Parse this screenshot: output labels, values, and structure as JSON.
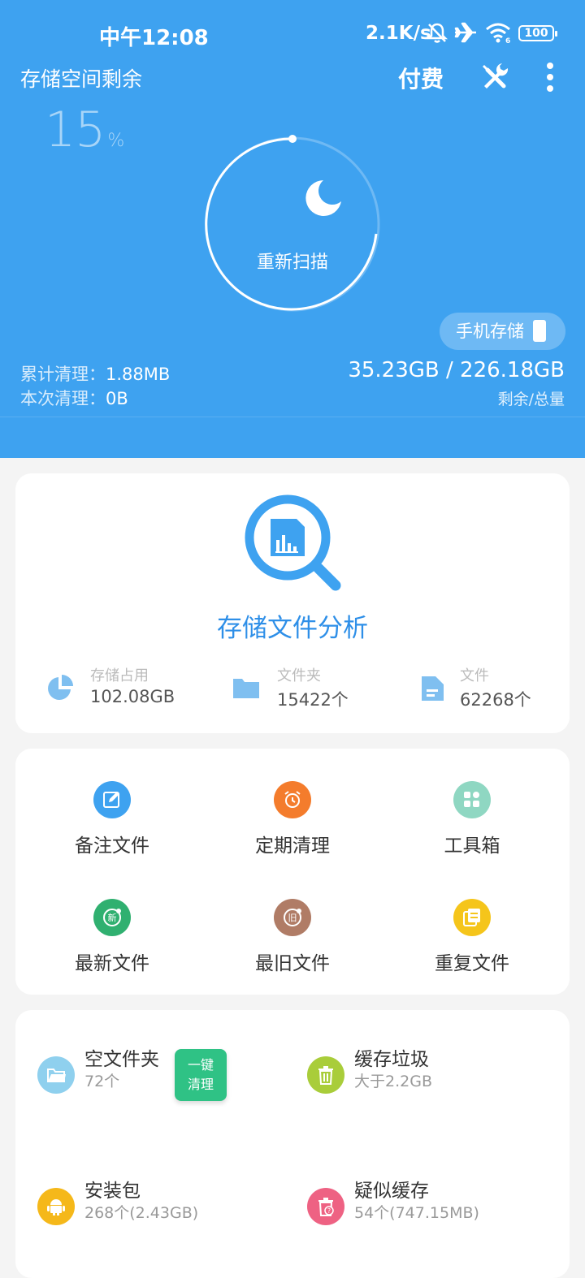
{
  "status_bar": {
    "time": "中午12:08",
    "net_speed": "2.1K/s",
    "battery": "100"
  },
  "header": {
    "title": "存储空间剩余",
    "pay_label": "付费",
    "percent_value": "15",
    "percent_sign": "%",
    "rescan_label": "重新扫描",
    "storage_type_label": "手机存储",
    "cumulative_clean_label": "累计清理：",
    "cumulative_clean_value": "1.88MB",
    "current_clean_label": "本次清理：",
    "current_clean_value": "0B",
    "capacity": "35.23GB / 226.18GB",
    "capacity_label": "剩余/总量"
  },
  "analysis": {
    "title": "存储文件分析",
    "stats": [
      {
        "label": "存储占用",
        "value": "102.08GB",
        "icon": "pie-chart-icon"
      },
      {
        "label": "文件夹",
        "value": "15422个",
        "icon": "folder-icon"
      },
      {
        "label": "文件",
        "value": "62268个",
        "icon": "file-icon"
      }
    ]
  },
  "tools": [
    {
      "label": "备注文件",
      "color": "#3ea2f0",
      "icon": "note-edit-icon"
    },
    {
      "label": "定期清理",
      "color": "#f47c2c",
      "icon": "alarm-clock-icon"
    },
    {
      "label": "工具箱",
      "color": "#8fd7c2",
      "icon": "toolbox-grid-icon"
    },
    {
      "label": "最新文件",
      "color": "#30b070",
      "icon": "new-badge-icon"
    },
    {
      "label": "最旧文件",
      "color": "#b07c66",
      "icon": "old-badge-icon"
    },
    {
      "label": "重复文件",
      "color": "#f5c51b",
      "icon": "duplicate-file-icon"
    }
  ],
  "cleanup": {
    "items": [
      {
        "name": "空文件夹",
        "sub": "72个",
        "color": "#8fd0ee",
        "icon": "empty-folder-icon"
      },
      {
        "name": "缓存垃圾",
        "sub": "大于2.2GB",
        "color": "#a9cd3a",
        "icon": "trash-icon"
      },
      {
        "name": "安装包",
        "sub": "268个(2.43GB)",
        "color": "#f5b81a",
        "icon": "android-icon"
      },
      {
        "name": "疑似缓存",
        "sub": "54个(747.15MB)",
        "color": "#ee6283",
        "icon": "suspect-trash-icon"
      }
    ],
    "one_click_line1": "一键",
    "one_click_line2": "清理"
  }
}
